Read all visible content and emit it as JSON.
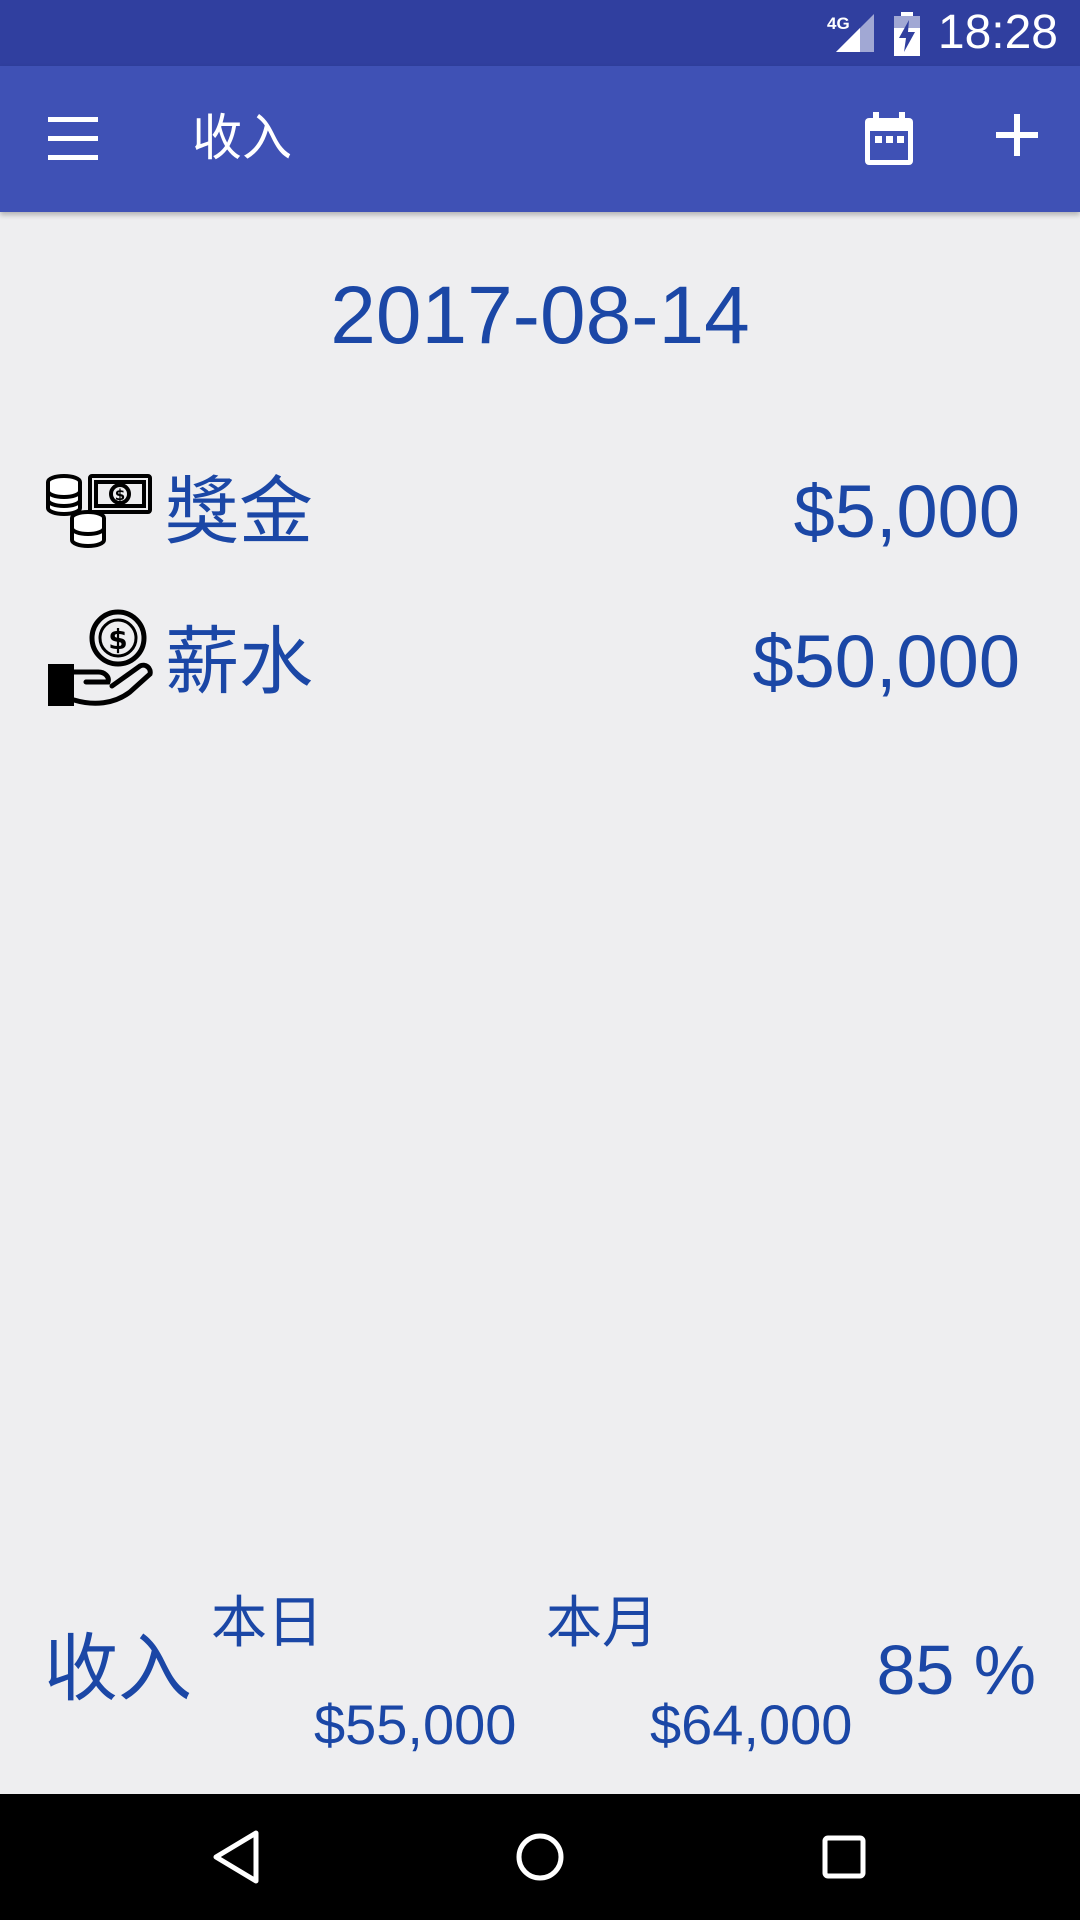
{
  "status_bar": {
    "network": "4G",
    "time": "18:28",
    "icons": [
      "signal-icon",
      "battery-charging-icon"
    ]
  },
  "app_bar": {
    "title": "收入",
    "icons": [
      "menu-icon",
      "calendar-icon",
      "add-icon"
    ]
  },
  "date": "2017-08-14",
  "entries": [
    {
      "icon": "money-coins-icon",
      "label": "獎金",
      "amount": "$5,000"
    },
    {
      "icon": "salary-hand-icon",
      "label": "薪水",
      "amount": "$50,000"
    }
  ],
  "summary": {
    "title": "收入",
    "day_label": "本日",
    "day_value": "$55,000",
    "month_label": "本月",
    "month_value": "$64,000",
    "percent": "85 %"
  },
  "nav_bar": {
    "icons": [
      "back-icon",
      "home-icon",
      "recents-icon"
    ]
  },
  "colors": {
    "status_bar": "#303f9f",
    "app_bar": "#3f51b5",
    "text_accent": "#1b47a6",
    "background": "#eeeef0"
  }
}
